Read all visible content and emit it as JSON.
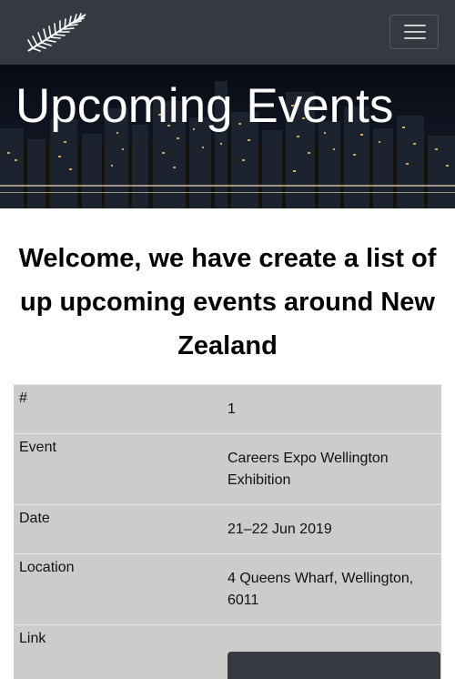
{
  "navbar": {
    "brand_icon": "silver-fern-icon",
    "menu_icon": "hamburger-menu-icon"
  },
  "hero": {
    "title": "Upcoming Events"
  },
  "welcome": {
    "text": "Welcome, we have create a list of up upcoming events around New Zealand"
  },
  "event_table": {
    "rows": [
      {
        "label": "#",
        "value": "1"
      },
      {
        "label": "Event",
        "value": "Careers Expo Wellington Exhibition"
      },
      {
        "label": "Date",
        "value": "21–22 Jun 2019"
      },
      {
        "label": "Location",
        "value": "4 Queens Wharf, Wellington, 6011"
      },
      {
        "label": "Link",
        "value": ""
      }
    ]
  },
  "colors": {
    "navbar_bg": "#343a40",
    "table_bg": "#cccccc",
    "hero_text": "#ffffff"
  }
}
